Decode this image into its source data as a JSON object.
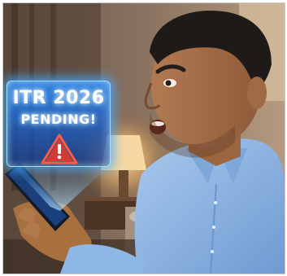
{
  "image": {
    "alert_title": "ITR 2026",
    "alert_subtitle": "PENDING!",
    "icons": [
      "warning-triangle-icon"
    ],
    "colors": {
      "hologram": "#2f8cf5",
      "warning": "#e23b2e",
      "shirt": "#8fb7e6"
    }
  }
}
